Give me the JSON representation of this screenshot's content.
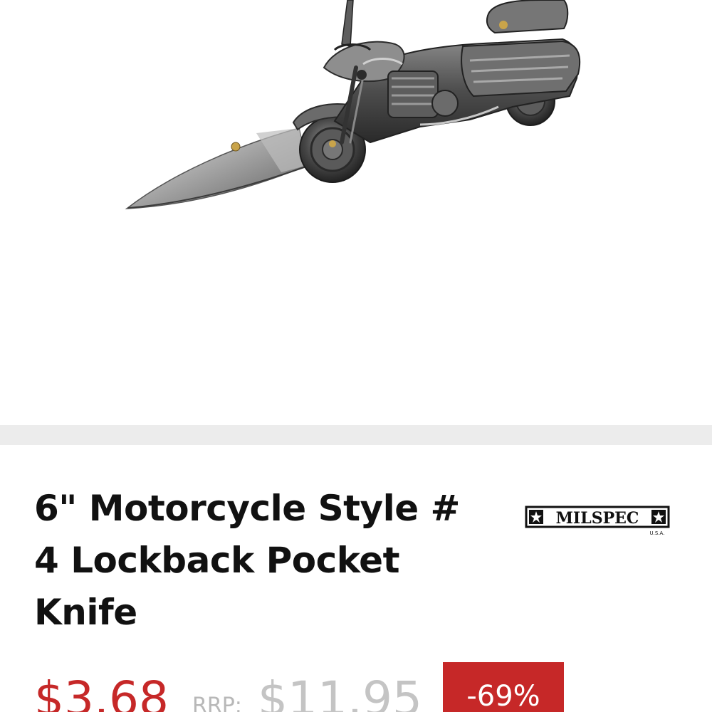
{
  "product": {
    "title": "6\" Motorcycle Style # 4 Lockback Pocket Knife",
    "image_subject": "motorcycle-style pocket knife with open blade",
    "brand": {
      "logo_text": "MILSPEC",
      "logo_subtext": "U.S.A."
    }
  },
  "pricing": {
    "sale_price": "$3.68",
    "rrp_label": "RRP:",
    "rrp_price": "$11.95",
    "discount": "-69%"
  },
  "colors": {
    "accent_red": "#c62828",
    "muted_gray": "#c4c4c4",
    "divider": "#ececec",
    "text": "#111111"
  }
}
